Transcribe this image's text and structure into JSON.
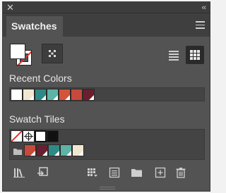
{
  "panel": {
    "tab_label": "Swatches",
    "close_glyph": "✕",
    "collapse_glyph": "‹‹"
  },
  "sections": {
    "recent_colors_label": "Recent Colors",
    "swatch_tiles_label": "Swatch Tiles"
  },
  "recent_colors": [
    {
      "color": "#ffffff",
      "triangle": false
    },
    {
      "color": "#efe7cf",
      "triangle": true
    },
    {
      "color": "#2f8a86",
      "triangle": true
    },
    {
      "color": "#5db3a6",
      "triangle": true
    },
    {
      "color": "#d2553a",
      "triangle": true
    },
    {
      "color": "#c64a3b",
      "triangle": false
    },
    {
      "color": "#6a1f2f",
      "triangle": true
    }
  ],
  "swatch_tiles_row1": [
    {
      "kind": "none"
    },
    {
      "kind": "registration"
    },
    {
      "kind": "white-black"
    },
    {
      "kind": "black"
    }
  ],
  "swatch_tiles_row2": [
    {
      "color": "#c64a3b",
      "triangle": true
    },
    {
      "color": "#6a1f2f",
      "triangle": true
    },
    {
      "color": "#2f8a86",
      "triangle": true
    },
    {
      "color": "#5db3a6",
      "triangle": true
    },
    {
      "color": "#efe7cf",
      "triangle": true
    }
  ],
  "icons": {
    "close": "close-icon",
    "collapse": "collapse-icon",
    "menu": "panel-menu-icon",
    "list_view": "list-view-icon",
    "grid_view": "grid-view-icon",
    "libraries": "swatch-libraries-icon",
    "show_kinds": "show-swatch-kinds-icon",
    "options": "swatch-options-icon",
    "new_group": "new-color-group-icon",
    "new_swatch": "new-swatch-icon",
    "delete": "delete-swatch-icon"
  }
}
